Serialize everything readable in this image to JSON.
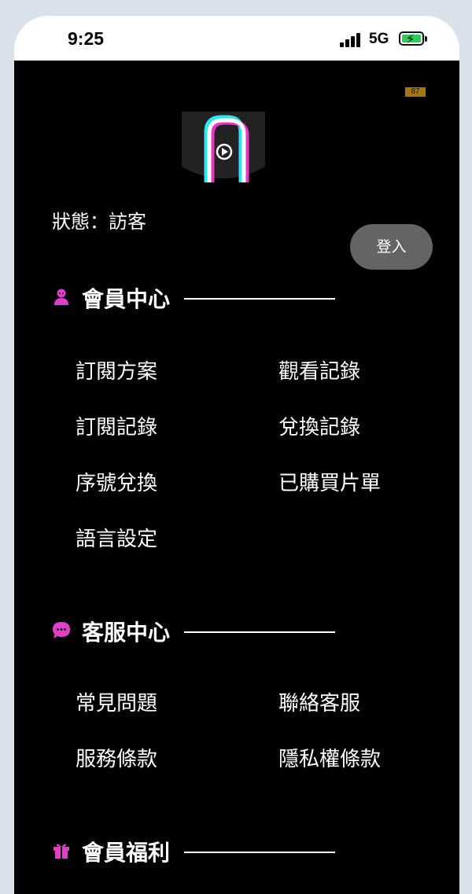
{
  "status_bar": {
    "time": "9:25",
    "network": "5G"
  },
  "badge": "87",
  "account": {
    "status_text": "狀態：訪客",
    "login_label": "登入"
  },
  "sections": {
    "member": {
      "title": "會員中心",
      "items": [
        "訂閱方案",
        "觀看記錄",
        "訂閱記錄",
        "兌換記錄",
        "序號兌換",
        "已購買片單",
        "語言設定"
      ]
    },
    "service": {
      "title": "客服中心",
      "items": [
        "常見問題",
        "聯絡客服",
        "服務條款",
        "隱私權條款"
      ]
    },
    "benefits": {
      "title": "會員福利"
    }
  },
  "colors": {
    "accent": "#e040c8",
    "background": "#000000",
    "button": "#646464",
    "logo_cyan": "#2ee6f0",
    "logo_magenta": "#e636c8"
  }
}
